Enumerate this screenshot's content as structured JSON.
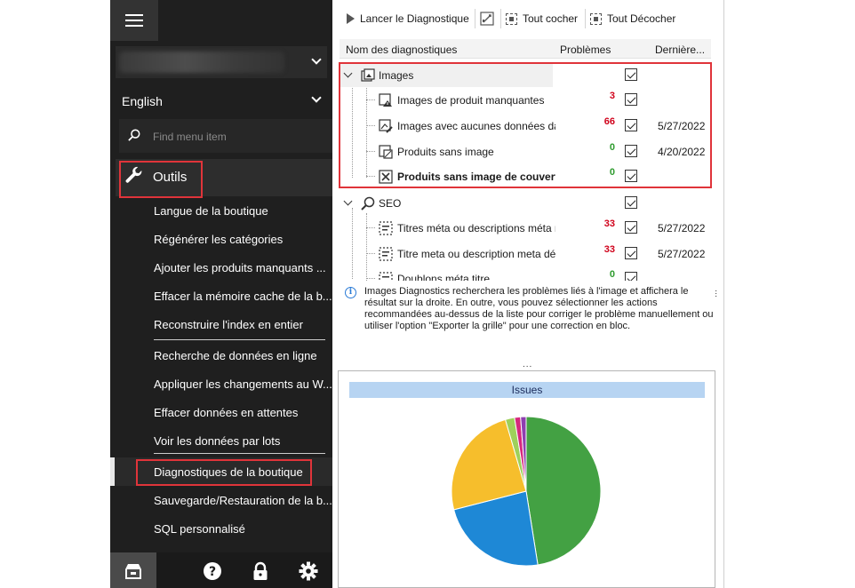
{
  "sidebar": {
    "language": "English",
    "search_placeholder": "Find menu item",
    "section_label": "Outils",
    "items": [
      {
        "label": "Langue de la boutique"
      },
      {
        "label": "Régénérer les catégories"
      },
      {
        "label": "Ajouter les produits manquants ..."
      },
      {
        "label": "Effacer la mémoire cache de la b..."
      },
      {
        "label": "Reconstruire l'index en entier"
      },
      {
        "label": "Recherche de données en ligne"
      },
      {
        "label": "Appliquer les changements au W..."
      },
      {
        "label": "Effacer données en attentes"
      },
      {
        "label": "Voir les données par lots"
      },
      {
        "label": "Diagnostiques de la boutique"
      },
      {
        "label": "Sauvegarde/Restauration de la b..."
      },
      {
        "label": "SQL personnalisé"
      }
    ],
    "bottom_icons": [
      "store-icon",
      "help-icon",
      "lock-icon",
      "settings-icon"
    ]
  },
  "toolbar": {
    "run_label": "Lancer le Diagnostique",
    "check_all_label": "Tout cocher",
    "uncheck_all_label": "Tout Décocher"
  },
  "grid": {
    "columns": [
      "Nom des diagnostiques",
      "Problèmes",
      "Dernière..."
    ],
    "groups": [
      {
        "name": "Images",
        "checked": true,
        "rows": [
          {
            "name": "Images de produit manquantes",
            "count": "3",
            "count_color": "#d0021b",
            "checked": true,
            "date": ""
          },
          {
            "name": "Images avec aucunes données dar",
            "count": "66",
            "count_color": "#d0021b",
            "checked": true,
            "date": "5/27/2022"
          },
          {
            "name": "Produits sans image",
            "count": "0",
            "count_color": "#2e9b2e",
            "checked": true,
            "date": "4/20/2022"
          },
          {
            "name": "Produits sans image de couvertur",
            "count": "0",
            "count_color": "#2e9b2e",
            "checked": true,
            "date": ""
          }
        ]
      },
      {
        "name": "SEO",
        "checked": true,
        "rows": [
          {
            "name": "Titres méta ou descriptions méta r",
            "count": "33",
            "count_color": "#d0021b",
            "checked": true,
            "date": "5/27/2022"
          },
          {
            "name": "Titre meta ou description meta dé",
            "count": "33",
            "count_color": "#d0021b",
            "checked": true,
            "date": "5/27/2022"
          },
          {
            "name": "Doublons méta titre",
            "count": "0",
            "count_color": "#2e9b2e",
            "checked": true,
            "date": ""
          }
        ]
      }
    ]
  },
  "info_text": "Images Diagnostics recherchera les problèmes liés à l'image et affichera le résultat sur la droite. En outre, vous pouvez sélectionner les actions recommandées au-dessus de la liste pour corriger le problème manuellement ou utiliser l'option \"Exporter la grille\" pour une correction en bloc.",
  "chart_data": {
    "type": "pie",
    "title": "Issues",
    "values": [
      47.5,
      23.5,
      24.5,
      2.0,
      1.3,
      1.2
    ],
    "colors": [
      "#43a143",
      "#1e88d6",
      "#f6be2c",
      "#9ed05b",
      "#d6287c",
      "#8e3fb0"
    ]
  }
}
